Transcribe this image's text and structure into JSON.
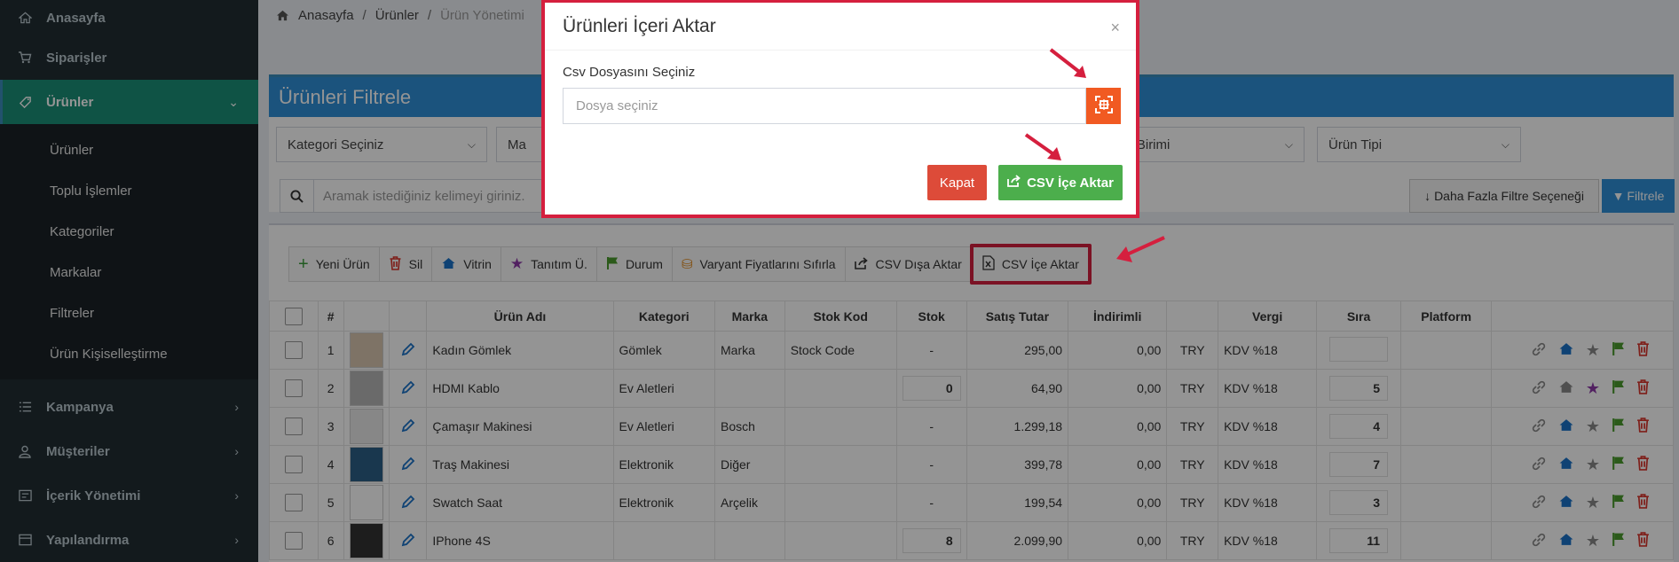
{
  "sidebar": {
    "items": [
      {
        "label": "Anasayfa",
        "icon": "home-icon"
      },
      {
        "label": "Siparişler",
        "icon": "cart-icon"
      },
      {
        "label": "Ürünler",
        "icon": "tag-icon"
      },
      {
        "label": "Kampanya",
        "icon": "list-icon"
      },
      {
        "label": "Müşteriler",
        "icon": "user-icon"
      },
      {
        "label": "İçerik Yönetimi",
        "icon": "content-icon"
      },
      {
        "label": "Yapılandırma",
        "icon": "config-icon"
      }
    ],
    "sub_items": [
      {
        "label": "Ürünler"
      },
      {
        "label": "Toplu İşlemler"
      },
      {
        "label": "Kategoriler"
      },
      {
        "label": "Markalar"
      },
      {
        "label": "Filtreler"
      },
      {
        "label": "Ürün Kişiselleştirme"
      }
    ]
  },
  "breadcrumb": {
    "home": "Anasayfa",
    "level1": "Ürünler",
    "level2": "Ürün Yönetimi"
  },
  "filter": {
    "title": "Ürünleri Filtrele",
    "category_select": "Kategori Seçiniz",
    "brand_select_partial": "Ma",
    "currency_select": "Para Birimi",
    "type_select": "Ürün Tipi",
    "search_placeholder": "Aramak istediğiniz kelimeyi giriniz.",
    "more_label": "Daha Fazla Filtre Seçeneği",
    "filter_label": "Filtrele"
  },
  "toolbar": {
    "new": "Yeni Ürün",
    "delete": "Sil",
    "showcase": "Vitrin",
    "promo": "Tanıtım Ü.",
    "status": "Durum",
    "reset_variant": "Varyant Fiyatlarını Sıfırla",
    "csv_export": "CSV Dışa Aktar",
    "csv_import": "CSV İçe Aktar"
  },
  "table": {
    "headers": [
      "#",
      "Ürün Adı",
      "Kategori",
      "Marka",
      "Stok Kod",
      "Stok",
      "Satış Tutar",
      "İndirimli",
      "Vergi",
      "Sıra",
      "Platform"
    ],
    "rows": [
      {
        "no": "1",
        "name": "Kadın Gömlek",
        "category": "Gömlek",
        "brand": "Marka",
        "code": "Stock Code",
        "stock": "-",
        "price": "295,00",
        "discount": "0,00",
        "currency": "TRY",
        "tax": "KDV %18",
        "order": ""
      },
      {
        "no": "2",
        "name": "HDMI Kablo",
        "category": "Ev Aletleri",
        "brand": "",
        "code": "",
        "stock": "0",
        "price": "64,90",
        "discount": "0,00",
        "currency": "TRY",
        "tax": "KDV %18",
        "order": "5"
      },
      {
        "no": "3",
        "name": "Çamaşır Makinesi",
        "category": "Ev Aletleri",
        "brand": "Bosch",
        "code": "",
        "stock": "-",
        "price": "1.299,18",
        "discount": "0,00",
        "currency": "TRY",
        "tax": "KDV %18",
        "order": "4"
      },
      {
        "no": "4",
        "name": "Traş Makinesi",
        "category": "Elektronik",
        "brand": "Diğer",
        "code": "",
        "stock": "-",
        "price": "399,78",
        "discount": "0,00",
        "currency": "TRY",
        "tax": "KDV %18",
        "order": "7"
      },
      {
        "no": "5",
        "name": "Swatch Saat",
        "category": "Elektronik",
        "brand": "Arçelik",
        "code": "",
        "stock": "-",
        "price": "199,54",
        "discount": "0,00",
        "currency": "TRY",
        "tax": "KDV %18",
        "order": "3"
      },
      {
        "no": "6",
        "name": "IPhone 4S",
        "category": "",
        "brand": "",
        "code": "",
        "stock": "8",
        "price": "2.099,90",
        "discount": "0,00",
        "currency": "TRY",
        "tax": "KDV %18",
        "order": "11"
      }
    ]
  },
  "modal": {
    "title": "Ürünleri İçeri Aktar",
    "close_symbol": "×",
    "label": "Csv Dosyasını Seçiniz",
    "file_placeholder": "Dosya seçiniz",
    "close_button": "Kapat",
    "import_button": "CSV İçe Aktar"
  },
  "colors": {
    "sidebar_bg": "#222d32",
    "active_item": "#1b8f77",
    "primary": "#2f8fd8",
    "danger": "#dd4b39",
    "success": "#4cae4c",
    "highlight": "#d51f3e",
    "file_button": "#f15a22"
  }
}
